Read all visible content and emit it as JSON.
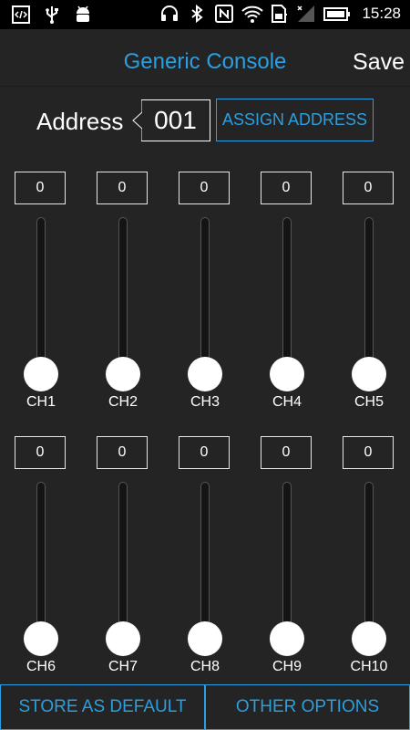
{
  "status_bar": {
    "left_icons": [
      "code-icon",
      "usb-icon",
      "android-debug-icon"
    ],
    "right_icons": [
      "headset-icon",
      "bluetooth-icon",
      "nfc-icon",
      "wifi-icon",
      "sim-icon",
      "signal-icon",
      "battery-icon"
    ],
    "time": "15:28"
  },
  "action_bar": {
    "title": "Generic Console",
    "save_label": "Save"
  },
  "address": {
    "label": "Address",
    "value": "001",
    "assign_label": "ASSIGN ADDRESS"
  },
  "channels": [
    {
      "label": "CH1",
      "value": "0"
    },
    {
      "label": "CH2",
      "value": "0"
    },
    {
      "label": "CH3",
      "value": "0"
    },
    {
      "label": "CH4",
      "value": "0"
    },
    {
      "label": "CH5",
      "value": "0"
    },
    {
      "label": "CH6",
      "value": "0"
    },
    {
      "label": "CH7",
      "value": "0"
    },
    {
      "label": "CH8",
      "value": "0"
    },
    {
      "label": "CH9",
      "value": "0"
    },
    {
      "label": "CH10",
      "value": "0"
    }
  ],
  "bottom": {
    "store_label": "STORE AS DEFAULT",
    "options_label": "OTHER OPTIONS"
  },
  "colors": {
    "accent": "#2b9fe0",
    "background": "#242424",
    "status_bar": "#000000"
  }
}
